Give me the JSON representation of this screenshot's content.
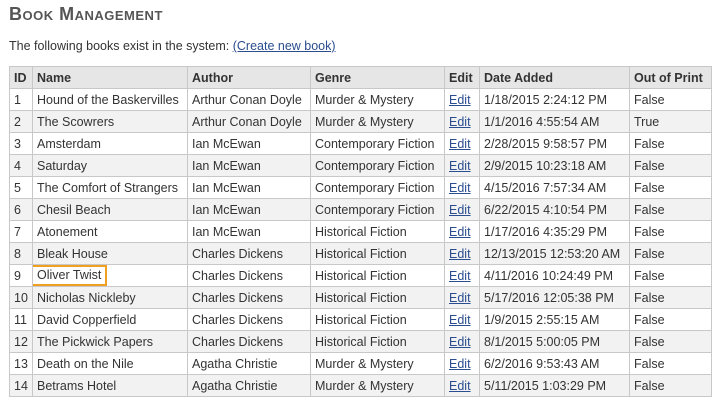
{
  "page": {
    "title": "Book Management",
    "intro_text": "The following books exist in the system: ",
    "create_link": "(Create new book)"
  },
  "table": {
    "headers": [
      "ID",
      "Name",
      "Author",
      "Genre",
      "Edit",
      "Date Added",
      "Out of Print"
    ],
    "rows": [
      {
        "id": "1",
        "name": "Hound of the Baskervilles",
        "author": "Arthur Conan Doyle",
        "genre": "Murder & Mystery",
        "edit": "Edit",
        "date": "1/18/2015 2:24:12 PM",
        "oop": "False"
      },
      {
        "id": "2",
        "name": "The Scowrers",
        "author": "Arthur Conan Doyle",
        "genre": "Murder & Mystery",
        "edit": "Edit",
        "date": "1/1/2016 4:55:54 AM",
        "oop": "True"
      },
      {
        "id": "3",
        "name": "Amsterdam",
        "author": "Ian McEwan",
        "genre": "Contemporary Fiction",
        "edit": "Edit",
        "date": "2/28/2015 9:58:57 PM",
        "oop": "False"
      },
      {
        "id": "4",
        "name": "Saturday",
        "author": "Ian McEwan",
        "genre": "Contemporary Fiction",
        "edit": "Edit",
        "date": "2/9/2015 10:23:18 AM",
        "oop": "False"
      },
      {
        "id": "5",
        "name": "The Comfort of Strangers",
        "author": "Ian McEwan",
        "genre": "Contemporary Fiction",
        "edit": "Edit",
        "date": "4/15/2016 7:57:34 AM",
        "oop": "False"
      },
      {
        "id": "6",
        "name": "Chesil Beach",
        "author": "Ian McEwan",
        "genre": "Contemporary Fiction",
        "edit": "Edit",
        "date": "6/22/2015 4:10:54 PM",
        "oop": "False"
      },
      {
        "id": "7",
        "name": "Atonement",
        "author": "Ian McEwan",
        "genre": "Historical Fiction",
        "edit": "Edit",
        "date": "1/17/2016 4:35:29 PM",
        "oop": "False"
      },
      {
        "id": "8",
        "name": "Bleak House",
        "author": "Charles Dickens",
        "genre": "Historical Fiction",
        "edit": "Edit",
        "date": "12/13/2015 12:53:20 AM",
        "oop": "False"
      },
      {
        "id": "9",
        "name": "Oliver Twist",
        "author": "Charles Dickens",
        "genre": "Historical Fiction",
        "edit": "Edit",
        "date": "4/11/2016 10:24:49 PM",
        "oop": "False"
      },
      {
        "id": "10",
        "name": "Nicholas Nickleby",
        "author": "Charles Dickens",
        "genre": "Historical Fiction",
        "edit": "Edit",
        "date": "5/17/2016 12:05:38 PM",
        "oop": "False"
      },
      {
        "id": "11",
        "name": "David Copperfield",
        "author": "Charles Dickens",
        "genre": "Historical Fiction",
        "edit": "Edit",
        "date": "1/9/2015 2:55:15 AM",
        "oop": "False"
      },
      {
        "id": "12",
        "name": "The Pickwick Papers",
        "author": "Charles Dickens",
        "genre": "Historical Fiction",
        "edit": "Edit",
        "date": "8/1/2015 5:00:05 PM",
        "oop": "False"
      },
      {
        "id": "13",
        "name": "Death on the Nile",
        "author": "Agatha Christie",
        "genre": "Murder & Mystery",
        "edit": "Edit",
        "date": "6/2/2016 9:53:43 AM",
        "oop": "False"
      },
      {
        "id": "14",
        "name": "Betrams Hotel",
        "author": "Agatha Christie",
        "genre": "Murder & Mystery",
        "edit": "Edit",
        "date": "5/11/2015 1:03:29 PM",
        "oop": "False"
      }
    ],
    "highlighted_row_id": "9"
  },
  "colors": {
    "link": "#2a4d8f",
    "header_bg": "#e6e6e6",
    "highlight_border": "#f0a020"
  }
}
